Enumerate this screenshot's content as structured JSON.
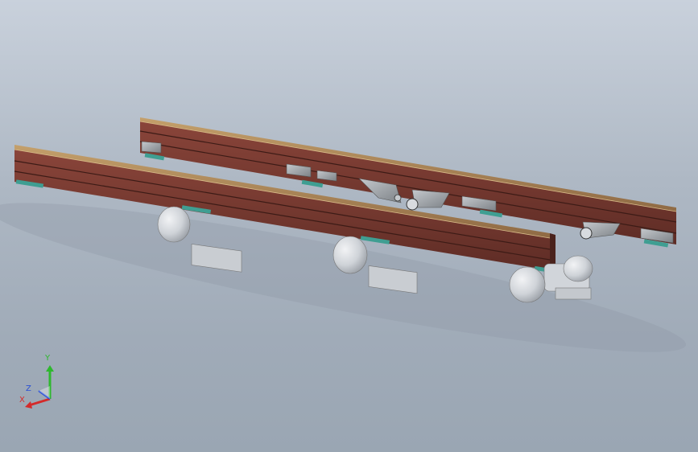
{
  "viewport": {
    "background_top": "#c9d1dc",
    "background_bottom": "#9aa6b3"
  },
  "model": {
    "beam_color": "#7a3b32",
    "beam_top_color": "#b08a5c",
    "bracket_color": "#9ea3a8",
    "motor_color": "#d6d9dd",
    "foot_color": "#3f9e92"
  },
  "triad": {
    "x_label": "X",
    "y_label": "Y",
    "z_label": "Z",
    "x_color": "#d42a2a",
    "y_color": "#2eb82e",
    "z_color": "#2a4fd4"
  }
}
